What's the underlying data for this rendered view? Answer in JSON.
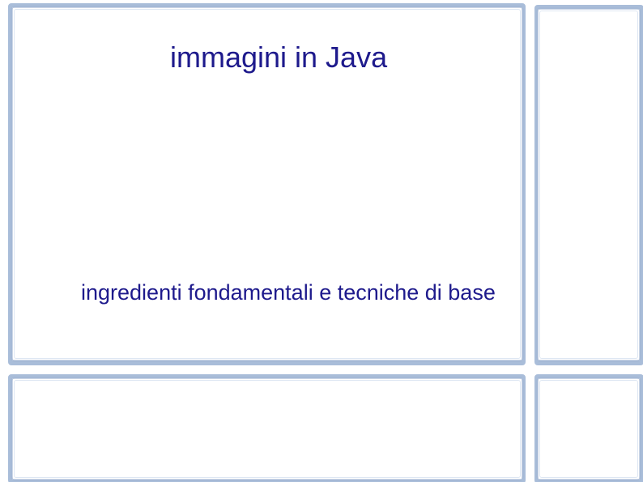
{
  "slide": {
    "title": "immagini in Java",
    "subtitle": "ingredienti fondamentali e tecniche di base"
  }
}
